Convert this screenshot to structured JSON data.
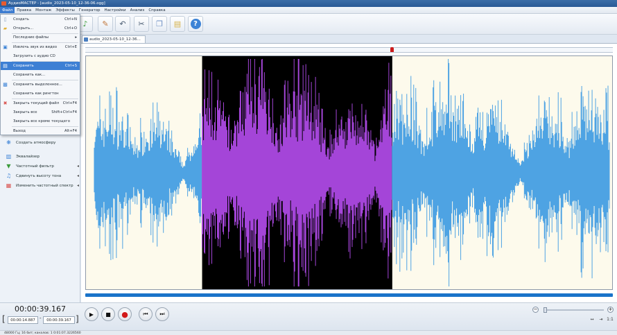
{
  "window": {
    "title": "АудиоМАСТЕР - [audio_2023-05-10_12-36-06.ogg]"
  },
  "menubar": [
    "Файл",
    "Правка",
    "Монтаж",
    "Эффекты",
    "Генератор",
    "Настройки",
    "Анализ",
    "Справка"
  ],
  "file_menu": [
    {
      "label": "Создать",
      "shortcut": "Ctrl+N",
      "icon": "new-file-icon"
    },
    {
      "label": "Открыть...",
      "shortcut": "Ctrl+O",
      "icon": "folder-open-icon"
    },
    {
      "label": "Последние файлы",
      "shortcut": "▸",
      "icon": ""
    },
    {
      "label": "Извлечь звук из видео",
      "shortcut": "Ctrl+E",
      "icon": "video-icon"
    },
    {
      "label": "Загрузить с аудио CD",
      "shortcut": "",
      "icon": ""
    },
    {
      "label": "Сохранить",
      "shortcut": "Ctrl+S",
      "icon": "save-icon"
    },
    {
      "label": "Сохранить как...",
      "shortcut": "",
      "icon": ""
    },
    {
      "label": "Сохранить выделенное...",
      "shortcut": "",
      "icon": "save-selection-icon"
    },
    {
      "label": "Сохранить как рингтон",
      "shortcut": "",
      "icon": ""
    },
    {
      "label": "Закрыть текущий файл",
      "shortcut": "Ctrl+F4",
      "icon": "close-file-icon"
    },
    {
      "label": "Закрыть все",
      "shortcut": "Shift+Ctrl+F4",
      "icon": ""
    },
    {
      "label": "Закрыть все кроме текущего",
      "shortcut": "",
      "icon": ""
    },
    {
      "label": "Выход",
      "shortcut": "Alt+F4",
      "icon": ""
    }
  ],
  "tools": [
    {
      "label": "Создать атмосферу",
      "icon": "atmosphere-icon",
      "arrow": ""
    },
    {
      "label": "Эквалайзер",
      "icon": "equalizer-icon",
      "arrow": ""
    },
    {
      "label": "Частотный фильтр",
      "icon": "filter-icon",
      "arrow": "◂"
    },
    {
      "label": "Сдвинуть высоту тона",
      "icon": "pitch-icon",
      "arrow": "◂"
    },
    {
      "label": "Изменить частотный спектр",
      "icon": "spectrum-icon",
      "arrow": "◂"
    }
  ],
  "tab": {
    "label": "audio_2023-05-10_12-36..."
  },
  "player": {
    "current_time": "00:00:39.167",
    "selection_start": "00:00:14.887",
    "selection_end": "00:00:39.167",
    "dash": "-",
    "zoom_level": 0.02
  },
  "zoom": {
    "minus": "−",
    "plus": "+",
    "fit": "↔",
    "scroll_left": "⇤",
    "scroll_right": "⇥",
    "ratio": "1:1"
  },
  "status": {
    "text": "48000 Гц; 16 бит; каналов: 1   0:01:07.3226560"
  },
  "colors": {
    "waveform": "#4ea3e3",
    "selection_wave": "#a445d8",
    "selection_bg": "#000000",
    "wave_bg": "#fdfaec"
  }
}
